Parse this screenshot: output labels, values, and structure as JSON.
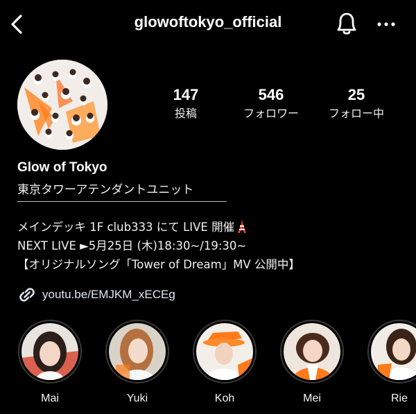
{
  "header": {
    "handle": "glowoftokyo_official",
    "icons": [
      "back-chevron-icon",
      "bell-icon",
      "more-icon"
    ]
  },
  "stats": [
    {
      "value": "147",
      "label": "投稿"
    },
    {
      "value": "546",
      "label": "フォロワー"
    },
    {
      "value": "25",
      "label": "フォロー中"
    }
  ],
  "profile": {
    "name": "Glow of Tokyo",
    "tagline": "東京タワーアテンダントユニット",
    "bio": [
      "メインデッキ 1F club333 にて LIVE 開催",
      "NEXT LIVE ►5月25日 (木)18:30~/19:30~",
      "【オリジナルソング「Tower of Dream」MV 公開中】"
    ],
    "link": "youtu.be/EMJKM_xECEg"
  },
  "highlights": [
    {
      "label": "Mai"
    },
    {
      "label": "Yuki"
    },
    {
      "label": "Koh"
    },
    {
      "label": "Mei"
    },
    {
      "label": "Rie"
    }
  ],
  "colors": {
    "background": "#000000",
    "accent": "#ff7a1a",
    "text": "#f5f5f5"
  }
}
